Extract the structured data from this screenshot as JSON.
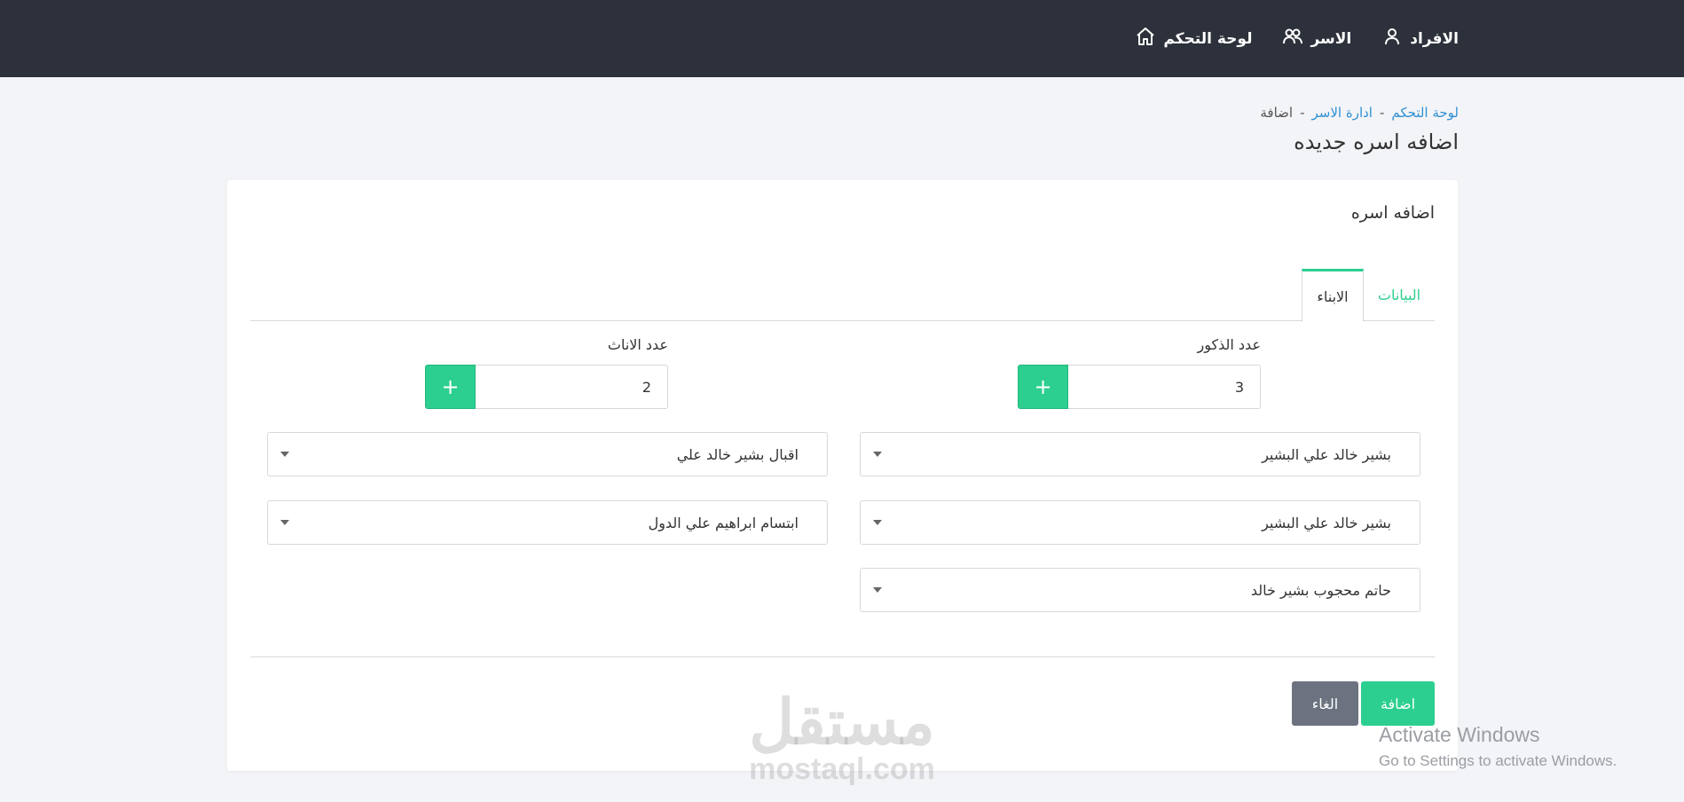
{
  "nav": {
    "dashboard": "لوحة التحكم",
    "families": "الاسر",
    "members": "الافراد"
  },
  "breadcrumb": {
    "home": "لوحة التحكم",
    "families": "ادارة الاسر",
    "current": "اضافة",
    "separator": "-"
  },
  "page": {
    "title": "اضافه اسره جديده"
  },
  "card": {
    "title": "اضافه اسره",
    "tabs": {
      "data": "البيانات",
      "children": "الابناء"
    },
    "males": {
      "label": "عدد الذكور",
      "value": "3",
      "plus": "+",
      "items": [
        "بشير خالد علي البشير",
        "بشير خالد علي البشير",
        "حاتم محجوب بشير خالد"
      ]
    },
    "females": {
      "label": "عدد الاناث",
      "value": "2",
      "plus": "+",
      "items": [
        "اقبال بشير خالد علي",
        "ابتسام ابراهيم علي الدول"
      ]
    },
    "buttons": {
      "add": "اضافة",
      "cancel": "الغاء"
    }
  },
  "watermark": {
    "arabic": "مستقل",
    "latin": "mostaql.com"
  },
  "activation": {
    "line1": "Activate Windows",
    "line2": "Go to Settings to activate Windows."
  },
  "colors": {
    "topbar": "#2c313b",
    "accent": "#2ccf8f",
    "link": "#2e8fd3",
    "cancel": "#6c7280"
  }
}
